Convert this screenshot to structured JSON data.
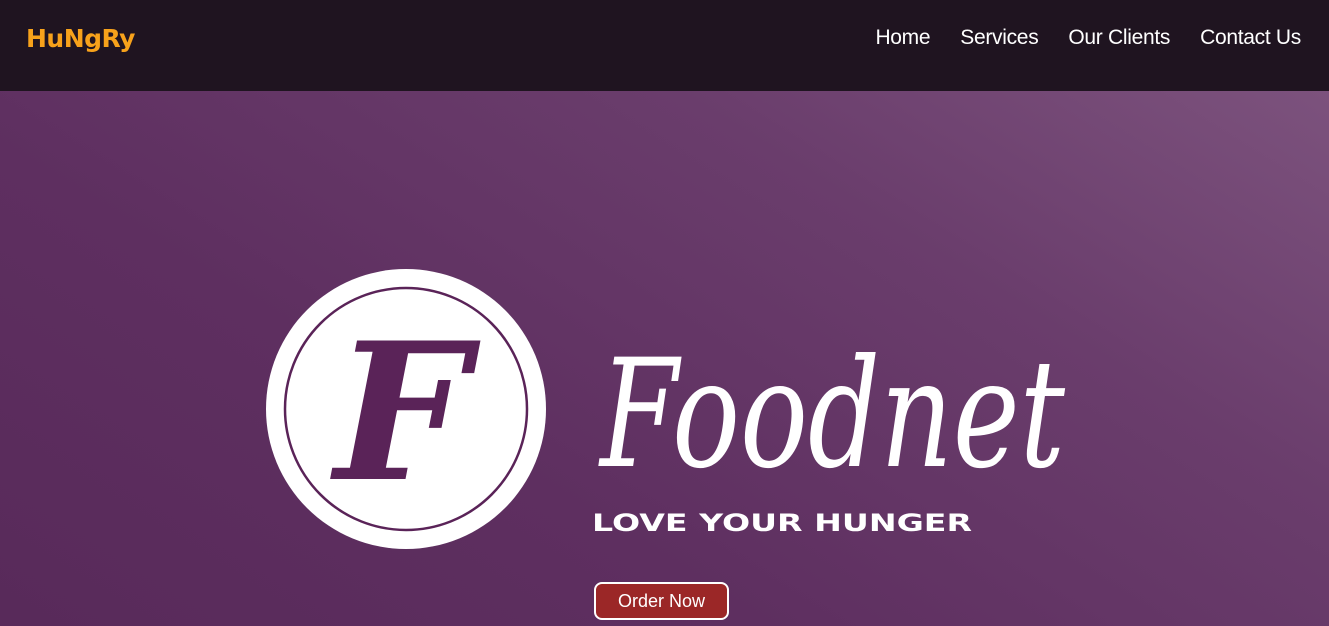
{
  "navbar": {
    "brand": "HuNgRy",
    "links": [
      "Home",
      "Services",
      "Our Clients",
      "Contact Us"
    ]
  },
  "hero": {
    "logo": {
      "emblem_letter": "F",
      "wordmark": "Foodnet",
      "tagline": "LOVE YOUR HUNGER"
    },
    "order_button": "Order Now"
  },
  "colors": {
    "navbar_bg": "#1f1420",
    "brand": "#f7a21b",
    "hero_bg": "#5e2f60",
    "emblem_letter": "#5a2358",
    "button_bg": "#9b2727"
  }
}
